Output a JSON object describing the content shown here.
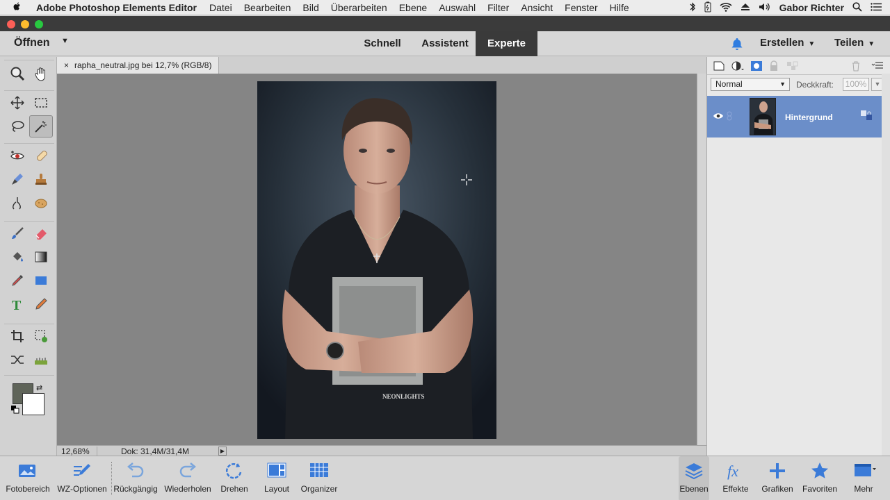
{
  "menubar": {
    "app_name": "Adobe Photoshop Elements Editor",
    "items": [
      "Datei",
      "Bearbeiten",
      "Bild",
      "Überarbeiten",
      "Ebene",
      "Auswahl",
      "Filter",
      "Ansicht",
      "Fenster",
      "Hilfe"
    ],
    "user": "Gabor Richter"
  },
  "modebar": {
    "open_label": "Öffnen",
    "modes": [
      "Schnell",
      "Assistent",
      "Experte"
    ],
    "active_mode": "Experte",
    "create_label": "Erstellen",
    "share_label": "Teilen"
  },
  "document": {
    "tab_title": "rapha_neutral.jpg bei 12,7% (RGB/8)",
    "zoom": "12,68%",
    "doc_info": "Dok: 31,4M/31,4M"
  },
  "colors": {
    "foreground": "#5f6459",
    "background": "#ffffff",
    "accent": "#6b8ec9",
    "bell": "#2f7de0"
  },
  "layers": {
    "blend_mode": "Normal",
    "opacity_label": "Deckkraft:",
    "opacity_value": "100%",
    "items": [
      {
        "name": "Hintergrund",
        "visible": true,
        "selected": true
      }
    ]
  },
  "bottombar": {
    "items": [
      "Fotobereich",
      "WZ-Optionen",
      "Rückgängig",
      "Wiederholen",
      "Drehen",
      "Layout",
      "Organizer",
      "Ebenen",
      "Effekte",
      "Grafiken",
      "Favoriten",
      "Mehr"
    ]
  }
}
